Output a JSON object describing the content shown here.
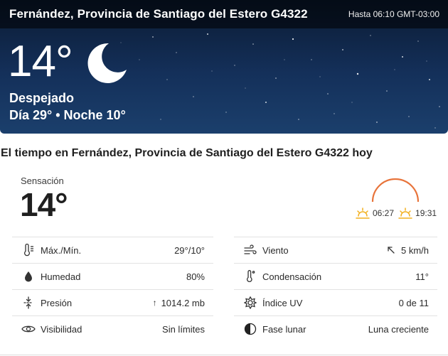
{
  "hero": {
    "location": "Fernández, Provincia de Santiago del Estero G4322",
    "until": "Hasta 06:10 GMT-03:00",
    "temperature": "14°",
    "condition_icon": "moon-icon",
    "condition": "Despejado",
    "day_night": "Día 29° • Noche 10°",
    "colors": {
      "sky_top": "#0b1b33",
      "sky_bottom": "#1b3f6c"
    }
  },
  "today": {
    "title": "El tiempo en Fernández, Provincia de Santiago del Estero G4322 hoy",
    "feels_like_label": "Sensación",
    "feels_like_value": "14°",
    "sunrise": "06:27",
    "sunset": "19:31",
    "colors": {
      "sun_arc": "#e8743b",
      "sun_icon": "#f2b01e"
    }
  },
  "details": {
    "left": [
      {
        "icon": "thermometer-icon",
        "label": "Máx./Mín.",
        "value": "29°/10°"
      },
      {
        "icon": "drop-icon",
        "label": "Humedad",
        "value": "80%"
      },
      {
        "icon": "pressure-icon",
        "label": "Presión",
        "value": "1014.2 mb"
      },
      {
        "icon": "eye-icon",
        "label": "Visibilidad",
        "value": "Sin límites"
      }
    ],
    "right": [
      {
        "icon": "wind-icon",
        "label": "Viento",
        "value": "5 km/h"
      },
      {
        "icon": "dew-point-icon",
        "label": "Condensación",
        "value": "11°"
      },
      {
        "icon": "uv-icon",
        "label": "Índice UV",
        "value": "0 de 11"
      },
      {
        "icon": "moon-phase-icon",
        "label": "Fase lunar",
        "value": "Luna creciente"
      }
    ]
  }
}
